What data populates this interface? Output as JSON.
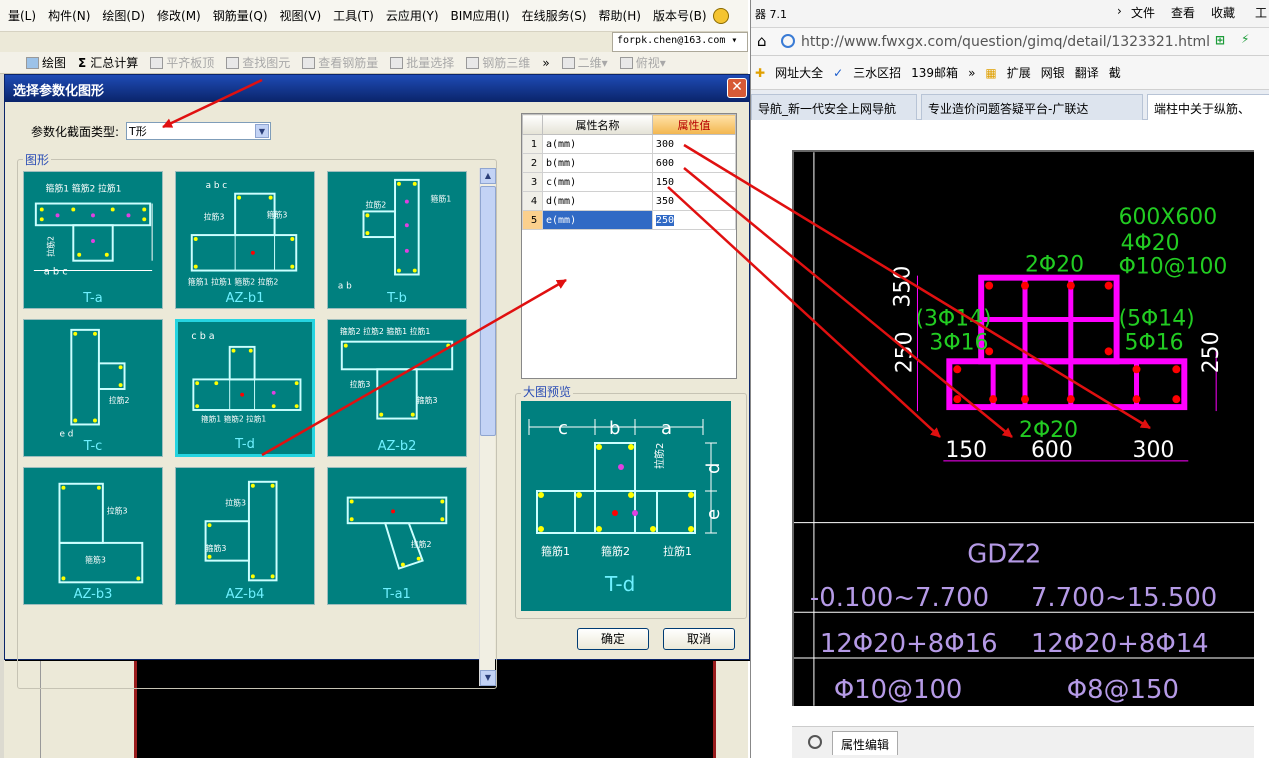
{
  "left_app": {
    "menu": [
      "量(L)",
      "构件(N)",
      "绘图(D)",
      "修改(M)",
      "钢筋量(Q)",
      "视图(V)",
      "工具(T)",
      "云应用(Y)",
      "BIM应用(I)",
      "在线服务(S)",
      "帮助(H)",
      "版本号(B)"
    ],
    "email": "forpk.chen@163.com",
    "toolbar": {
      "draw": "绘图",
      "sum": "汇总计算",
      "flat_top": "平齐板顶",
      "find_elem": "查找图元",
      "view_rebar": "查看钢筋量",
      "batch_select": "批量选择",
      "rebar_3d": "钢筋三维",
      "view_2d": "二维",
      "view_top": "俯视"
    }
  },
  "dialog": {
    "title": "选择参数化图形",
    "type_label": "参数化截面类型:",
    "type_value": "T形",
    "group_label": "图形",
    "shapes": [
      "T-a",
      "AZ-b1",
      "T-b",
      "T-c",
      "T-d",
      "AZ-b2",
      "AZ-b3",
      "AZ-b4",
      "T-a1"
    ],
    "selected_shape": "T-d",
    "table": {
      "col_name": "属性名称",
      "col_value": "属性值",
      "rows": [
        {
          "idx": "1",
          "name": "a(mm)",
          "value": "300"
        },
        {
          "idx": "2",
          "name": "b(mm)",
          "value": "600"
        },
        {
          "idx": "3",
          "name": "c(mm)",
          "value": "150"
        },
        {
          "idx": "4",
          "name": "d(mm)",
          "value": "350"
        },
        {
          "idx": "5",
          "name": "e(mm)",
          "value": "250"
        }
      ]
    },
    "preview_label": "大图预览",
    "preview": {
      "c": "c",
      "b": "b",
      "a": "a",
      "d": "d",
      "e": "e",
      "tie2": "拉筋2",
      "hoop1": "箍筋1",
      "hoop2": "箍筋2",
      "tie1": "拉筋1",
      "name": "T-d"
    },
    "ok": "确定",
    "cancel": "取消"
  },
  "browser": {
    "title": "器 7.1",
    "menu": [
      "文件",
      "查看",
      "收藏",
      "工"
    ],
    "url": "http://www.fwxgx.com/question/gimq/detail/1323321.html",
    "favorites": [
      "网址大全",
      "三水区招",
      "139邮箱",
      "扩展",
      "网银",
      "翻译",
      "截"
    ],
    "tabs": [
      "导航_新一代安全上网导航",
      "专业造价问题答疑平台-广联达",
      "端柱中关于纵筋、"
    ],
    "prop_panel": "属性编辑"
  },
  "cad": {
    "size": "600X600",
    "top_bars": "4Φ20",
    "stirrup": "Φ10@100",
    "top_flange": "2Φ20",
    "left_a": "(3Φ14)",
    "left_b": "3Φ16",
    "right_a": "(5Φ14)",
    "right_b": "5Φ16",
    "bottom_bars": "2Φ20",
    "dim_350": "350",
    "dim_250_l": "250",
    "dim_250_r": "250",
    "dim_150": "150",
    "dim_600": "600",
    "dim_300": "300",
    "label": "GDZ2",
    "elev1": "-0.100~7.700",
    "elev2": "7.700~15.500",
    "long1": "12Φ20+8Φ16",
    "long2": "12Φ20+8Φ14",
    "hoop1": "Φ10@100",
    "hoop2": "Φ8@150"
  },
  "colors": {
    "teal": "#00807f",
    "title_blue": "#0a246a",
    "magenta": "#ff00ff",
    "red_arrow": "#e01010"
  }
}
